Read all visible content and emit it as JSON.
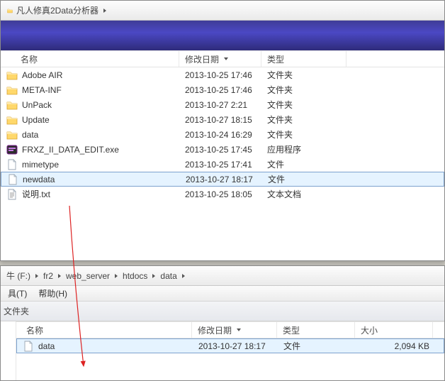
{
  "window1": {
    "breadcrumbs": [
      "凡人修真2Data分析器"
    ],
    "columns": {
      "name": "名称",
      "date": "修改日期",
      "type": "类型"
    },
    "rows": [
      {
        "icon": "folder",
        "name": "Adobe AIR",
        "date": "2013-10-25 17:46",
        "type": "文件夹"
      },
      {
        "icon": "folder",
        "name": "META-INF",
        "date": "2013-10-25 17:46",
        "type": "文件夹"
      },
      {
        "icon": "folder",
        "name": "UnPack",
        "date": "2013-10-27 2:21",
        "type": "文件夹"
      },
      {
        "icon": "folder",
        "name": "Update",
        "date": "2013-10-27 18:15",
        "type": "文件夹"
      },
      {
        "icon": "folder",
        "name": "data",
        "date": "2013-10-24 16:29",
        "type": "文件夹"
      },
      {
        "icon": "exe",
        "name": "FRXZ_II_DATA_EDIT.exe",
        "date": "2013-10-25 17:45",
        "type": "应用程序"
      },
      {
        "icon": "file",
        "name": "mimetype",
        "date": "2013-10-25 17:41",
        "type": "文件"
      },
      {
        "icon": "file",
        "name": "newdata",
        "date": "2013-10-27 18:17",
        "type": "文件",
        "selected": true
      },
      {
        "icon": "txt",
        "name": "说明.txt",
        "date": "2013-10-25 18:05",
        "type": "文本文档"
      }
    ]
  },
  "window2": {
    "breadcrumbs_prefix": "牛 (F:)",
    "breadcrumbs": [
      "fr2",
      "web_server",
      "htdocs",
      "data"
    ],
    "menu": {
      "tools": "具(T)",
      "help": "帮助(H)"
    },
    "toolbar_label": "文件夹",
    "columns": {
      "name": "名称",
      "date": "修改日期",
      "type": "类型",
      "size": "大小"
    },
    "rows": [
      {
        "icon": "file",
        "name": "data",
        "date": "2013-10-27 18:17",
        "type": "文件",
        "size": "2,094 KB",
        "selected": true
      }
    ]
  }
}
